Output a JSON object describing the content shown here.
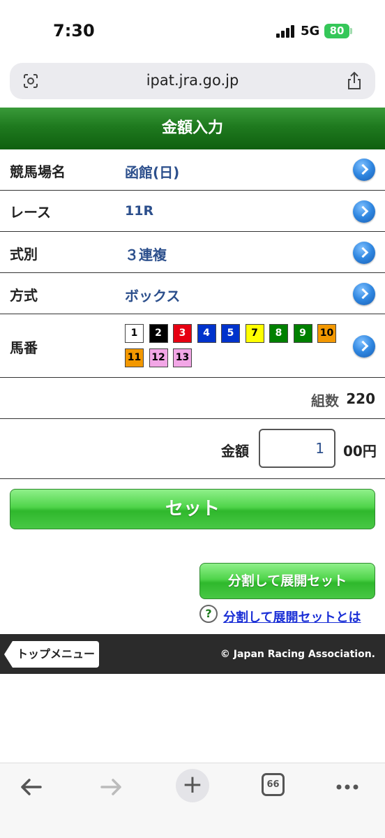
{
  "status_bar": {
    "time": "7:30",
    "network": "5G",
    "battery": "80"
  },
  "url_bar": {
    "url": "ipat.jra.go.jp"
  },
  "header": {
    "title": "金額入力"
  },
  "rows": {
    "venue": {
      "label": "競馬場名",
      "value": "函館(日)"
    },
    "race": {
      "label": "レース",
      "value": "11R"
    },
    "bet_type": {
      "label": "式別",
      "value": "３連複"
    },
    "method": {
      "label": "方式",
      "value": "ボックス"
    },
    "horses": {
      "label": "馬番",
      "numbers": [
        {
          "n": "1",
          "bg": "#ffffff",
          "fg": "#000000"
        },
        {
          "n": "2",
          "bg": "#000000",
          "fg": "#ffffff"
        },
        {
          "n": "3",
          "bg": "#e60012",
          "fg": "#ffffff"
        },
        {
          "n": "4",
          "bg": "#0033cc",
          "fg": "#ffffff"
        },
        {
          "n": "5",
          "bg": "#0033cc",
          "fg": "#ffffff"
        },
        {
          "n": "7",
          "bg": "#ffff00",
          "fg": "#000000"
        },
        {
          "n": "8",
          "bg": "#008000",
          "fg": "#ffffff"
        },
        {
          "n": "9",
          "bg": "#008000",
          "fg": "#ffffff"
        },
        {
          "n": "10",
          "bg": "#f39800",
          "fg": "#000000"
        },
        {
          "n": "11",
          "bg": "#f39800",
          "fg": "#000000"
        },
        {
          "n": "12",
          "bg": "#f2a6e6",
          "fg": "#000000"
        },
        {
          "n": "13",
          "bg": "#f2a6e6",
          "fg": "#000000"
        }
      ]
    }
  },
  "combinations": {
    "label": "組数",
    "value": "220"
  },
  "amount": {
    "label": "金額",
    "value": "1",
    "unit": "00円"
  },
  "buttons": {
    "set": "セット",
    "split_set": "分割して展開セット",
    "help_mark": "?",
    "help_link": "分割して展開セットとは"
  },
  "footer": {
    "top_menu": "トップメニュー",
    "copyright": "© Japan Racing Association."
  },
  "toolbar": {
    "tabs_count": "66"
  },
  "colors": {
    "header_green": "#1f7a1f",
    "value_blue": "#2c4f8c",
    "link_blue": "#1a2fd6"
  }
}
